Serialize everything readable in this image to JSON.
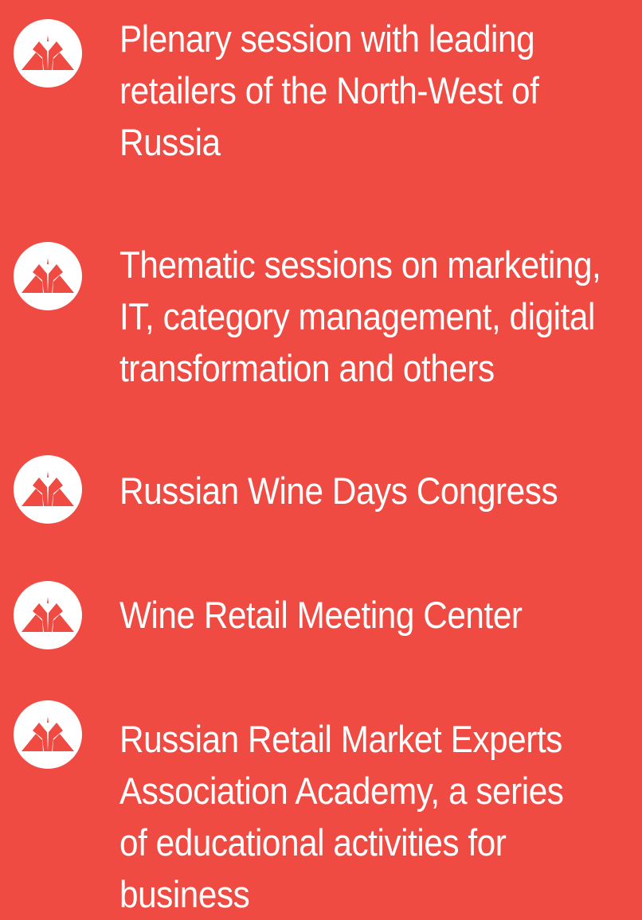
{
  "page": {
    "background_color": "#EF4B43",
    "text_color": "#FFFFFF"
  },
  "features": {
    "icon": "event-logo-icon",
    "items": [
      {
        "lines": [
          "Plenary session with leading",
          "retailers of the North-West of",
          "Russia"
        ]
      },
      {
        "lines": [
          "Thematic sessions on marketing,",
          "IT, category management, digital",
          "transformation and others"
        ]
      },
      {
        "lines": [
          "Russian Wine Days Congress"
        ]
      },
      {
        "lines": [
          "Wine Retail Meeting Center"
        ]
      },
      {
        "lines": [
          "Russian Retail Market Experts",
          "Association Academy, a series",
          "of educational activities for",
          "business"
        ]
      }
    ]
  }
}
